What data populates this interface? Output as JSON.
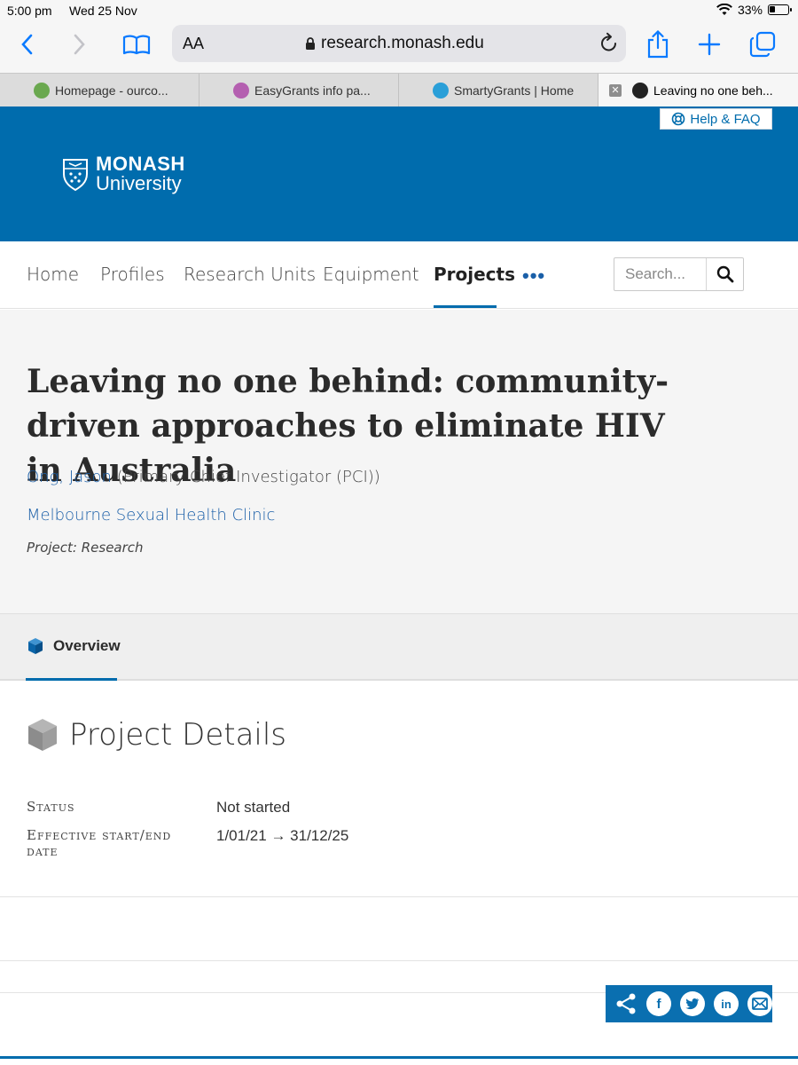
{
  "status_bar": {
    "time": "5:00 pm",
    "date": "Wed 25 Nov",
    "battery": "33%",
    "battery_level": 0.33
  },
  "browser": {
    "text_size_label": "AA",
    "url": "research.monash.edu",
    "tabs": [
      {
        "label": "Homepage - ourco...",
        "fav_color": "#6aa84f"
      },
      {
        "label": "EasyGrants info pa...",
        "fav_color": "#b45fb0"
      },
      {
        "label": "SmartyGrants | Home",
        "fav_color": "#2a9fd8"
      },
      {
        "label": "Leaving no one beh...",
        "fav_color": "#222222",
        "active": true
      }
    ]
  },
  "header": {
    "help_label": "Help & FAQ",
    "logo_line1": "MONASH",
    "logo_line2": "University",
    "brand_color": "#006cad"
  },
  "nav": {
    "items": [
      "Home",
      "Profiles",
      "Research Units",
      "Equipment",
      "Projects"
    ],
    "active": "Projects",
    "more": "•••",
    "search_placeholder": "Search..."
  },
  "project": {
    "title": "Leaving no one behind: community-driven approaches to eliminate HIV in Australia",
    "investigator_name": "Ong, Jason",
    "investigator_role": " (Primary Chief Investigator (PCI))",
    "organisation": "Melbourne Sexual Health Clinic",
    "type": "Project: Research"
  },
  "tabs": {
    "overview": "Overview"
  },
  "details": {
    "heading": "Project Details",
    "rows": [
      {
        "key": "Status",
        "value": "Not started"
      },
      {
        "key": "Effective start/end date",
        "value": "1/01/21 → 31/12/25"
      }
    ]
  },
  "share": {
    "icons": [
      "share-icon",
      "facebook-icon",
      "twitter-icon",
      "linkedin-icon",
      "email-icon"
    ]
  }
}
